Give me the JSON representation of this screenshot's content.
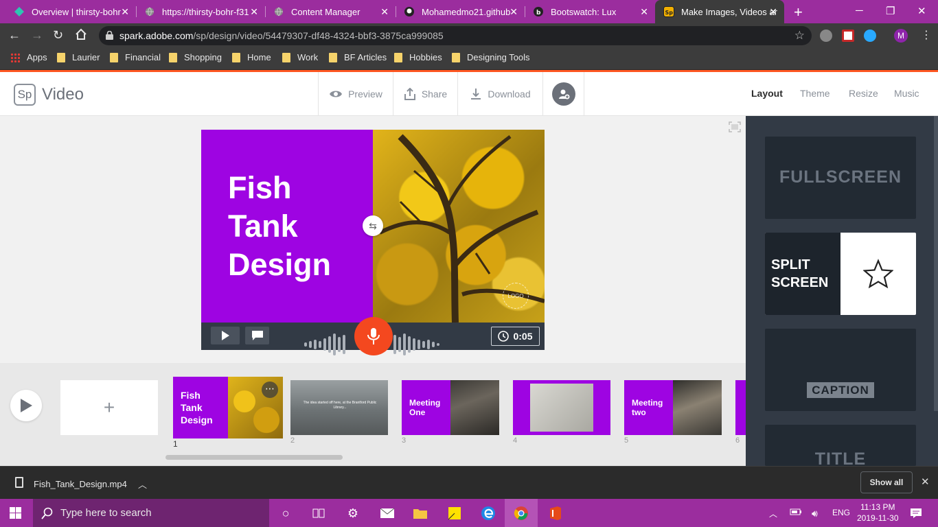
{
  "browser": {
    "tabs": [
      {
        "title": "Overview | thirsty-bohr",
        "icon": "netlify-icon"
      },
      {
        "title": "https://thirsty-bohr-f31",
        "icon": "globe-icon"
      },
      {
        "title": "Content Manager",
        "icon": "globe-icon"
      },
      {
        "title": "Mohamedmo21.github",
        "icon": "github-icon"
      },
      {
        "title": "Bootswatch: Lux",
        "icon": "bootswatch-icon"
      },
      {
        "title": "Make Images, Videos ar",
        "icon": "spark-icon"
      }
    ],
    "new_tab_label": "+",
    "url_host": "spark.adobe.com",
    "url_path": "/sp/design/video/54479307-df48-4324-bbf3-3875ca999085",
    "profile_initial": "M",
    "bookmarks": [
      "Apps",
      "Laurier",
      "Financial",
      "Shopping",
      "Home",
      "Work",
      "BF Articles",
      "Hobbies",
      "Designing Tools"
    ]
  },
  "spark": {
    "logo": "Sp",
    "app_title": "Video",
    "actions": {
      "preview": "Preview",
      "share": "Share",
      "download": "Download"
    },
    "right_nav": [
      "Layout",
      "Theme",
      "Resize",
      "Music"
    ],
    "accent": "#9e04e2",
    "record_color": "#f4481f"
  },
  "slide": {
    "title_lines": [
      "Fish",
      "Tank",
      "Design"
    ],
    "logo_placeholder": "LOGO",
    "duration": "0:05"
  },
  "filmstrip": {
    "add_label": "+",
    "thumbs": [
      {
        "num": "1",
        "title": "Fish\nTank\nDesign",
        "kind": "split"
      },
      {
        "num": "2",
        "title": "",
        "caption": "The idea started off here, at the Brantford Public Library...",
        "kind": "full"
      },
      {
        "num": "3",
        "title": "Meeting\nOne",
        "kind": "split"
      },
      {
        "num": "4",
        "title": "",
        "kind": "framed"
      },
      {
        "num": "5",
        "title": "Meeting\ntwo",
        "kind": "split"
      },
      {
        "num": "6",
        "title": "",
        "kind": "partial"
      }
    ]
  },
  "layouts": {
    "options": [
      "FULLSCREEN",
      "SPLIT\nSCREEN",
      "CAPTION",
      "TITLE"
    ]
  },
  "download_shelf": {
    "file_name": "Fish_Tank_Design.mp4",
    "show_all": "Show all"
  },
  "taskbar": {
    "search_placeholder": "Type here to search",
    "language": "ENG",
    "time": "11:13 PM",
    "date": "2019-11-30"
  }
}
